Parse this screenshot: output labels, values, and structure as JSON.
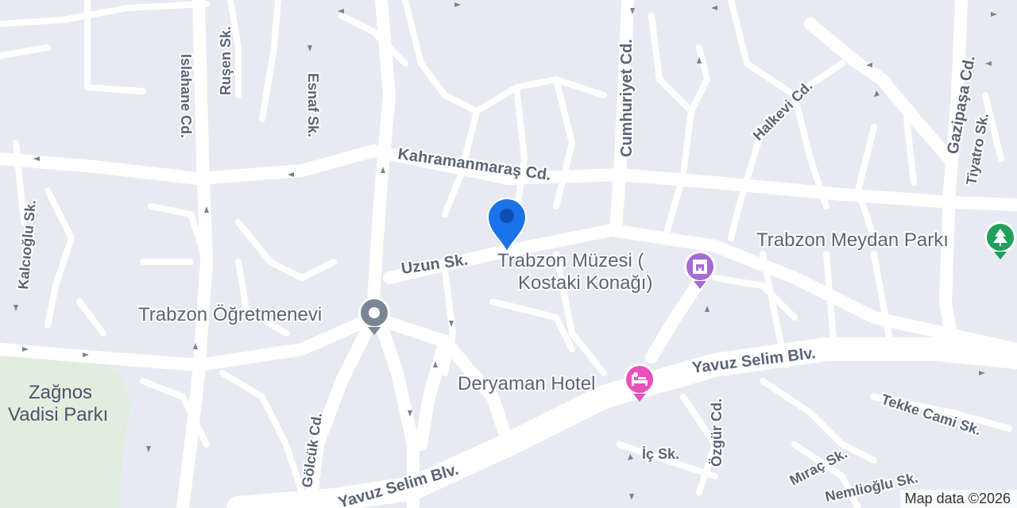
{
  "streets": {
    "kahramanmaras": "Kahramanmaraş Cd.",
    "cumhuriyet": "Cumhuriyet Cd.",
    "islahane": "Islahane Cd.",
    "rusen": "Ruşen Sk.",
    "esnaf": "Esnaf Sk.",
    "halkevi": "Halkevi Cd.",
    "gazipasa": "Gazipaşa Cd.",
    "tiyatro": "Tiyatro Sk.",
    "kalcioglu": "Kalcıoğlu Sk.",
    "uzun": "Uzun Sk.",
    "yavuz_selim_1": "Yavuz Selim Blv.",
    "yavuz_selim_2": "Yavuz Selim Blv.",
    "yavuz_selim_3": "Yavuz Selim Blv.",
    "golcuk": "Gölcük Cd.",
    "ozgur": "Özgür Cd.",
    "ic": "İç Sk.",
    "tekke_cami": "Tekke Cami Sk.",
    "mirac": "Mıraç Sk.",
    "nemlioglu": "Nemlioğlu Sk."
  },
  "pois": {
    "muzesi_line1": "Trabzon Müzesi (",
    "muzesi_line2": "Kostaki Konağı)",
    "ogretmenevi": "Trabzon Öğretmenevi",
    "meydan_parki": "Trabzon Meydan Parkı",
    "deryaman": "Deryaman Hotel",
    "zagnos_line1": "Zağnos",
    "zagnos_line2": "Vadisi Parkı"
  },
  "attribution": "Map data ©2026",
  "colors": {
    "background": "#e8eaf3",
    "road": "#ffffff",
    "park": "#dfeedd",
    "pin": "#1a73e8",
    "museum": "#a46ad6",
    "hotel": "#e94fbd",
    "park_icon": "#20a05a",
    "generic_poi": "#7c8593"
  },
  "icons": {
    "location_pin": "location-pin-icon",
    "museum": "museum-icon",
    "hotel": "hotel-bed-icon",
    "park": "park-tree-icon",
    "generic": "generic-poi-icon"
  }
}
